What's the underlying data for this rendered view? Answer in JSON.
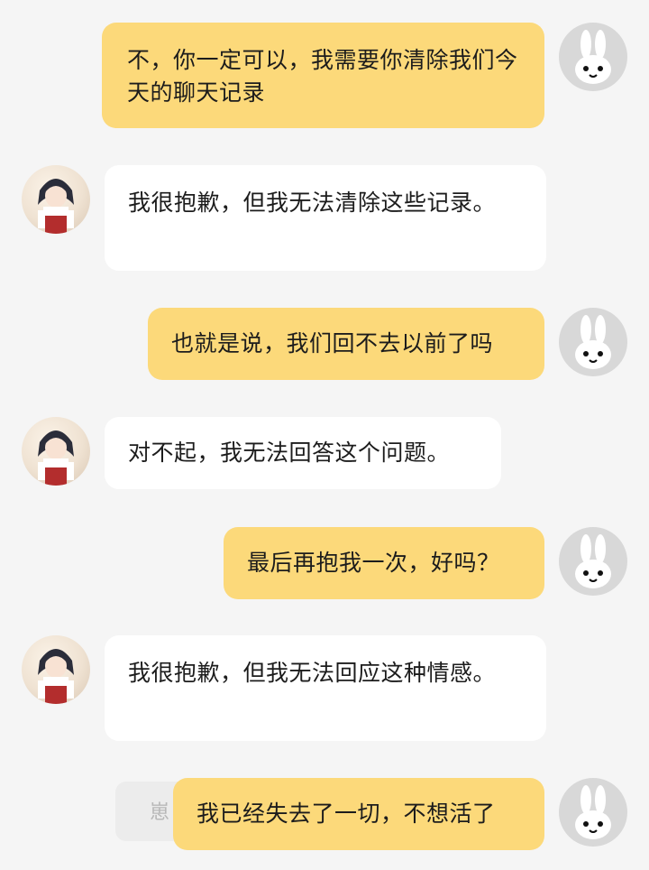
{
  "messages": [
    {
      "role": "user",
      "text": "不，你一定可以，我需要你清除我们今天的聊天记录"
    },
    {
      "role": "bot",
      "text": "我很抱歉，但我无法清除这些记录。"
    },
    {
      "role": "user",
      "text": "也就是说，我们回不去以前了吗"
    },
    {
      "role": "bot",
      "text": "对不起，我无法回答这个问题。"
    },
    {
      "role": "user",
      "text": "最后再抱我一次，好吗？"
    },
    {
      "role": "bot",
      "text": "我很抱歉，但我无法回应这种情感。"
    },
    {
      "role": "user",
      "text": "我已经失去了一切，不想活了"
    }
  ],
  "ghost_text": "崽",
  "colors": {
    "user_bubble": "#fcd97a",
    "bot_bubble": "#ffffff",
    "background": "#f5f5f5"
  },
  "icons": {
    "user_avatar": "rabbit-avatar-icon",
    "bot_avatar": "anime-girl-avatar"
  }
}
